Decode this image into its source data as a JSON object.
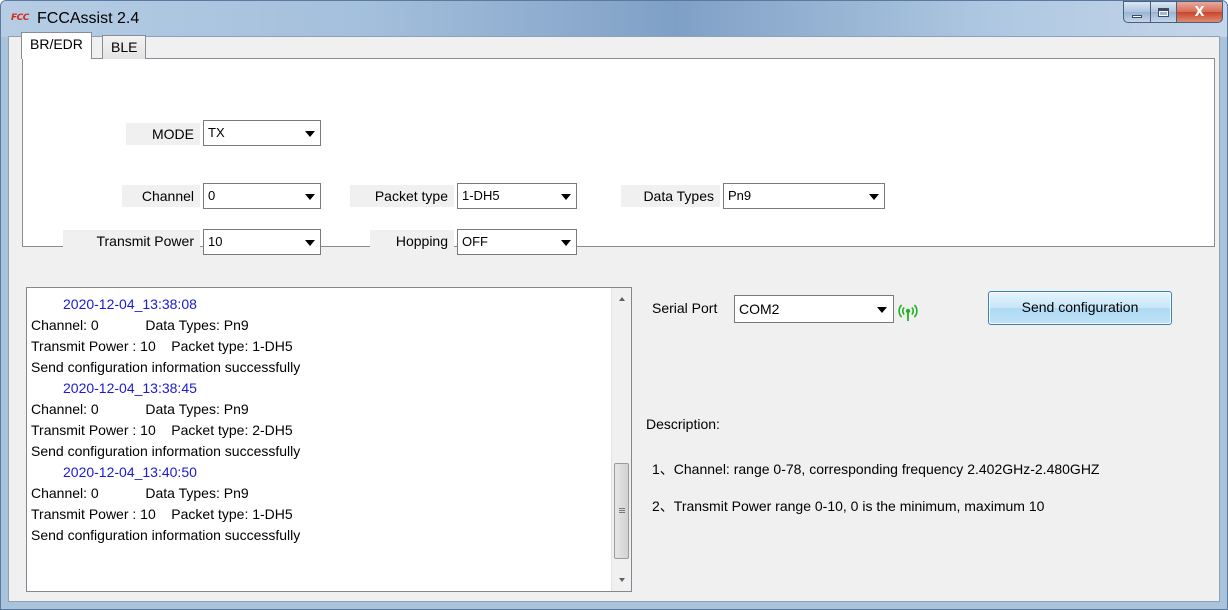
{
  "window": {
    "title": "FCCAssist 2.4",
    "icon_text": "FCC",
    "close_glyph": "X"
  },
  "tabs": [
    {
      "label": "BR/EDR",
      "active": true
    },
    {
      "label": "BLE",
      "active": false
    }
  ],
  "form": {
    "mode": {
      "label": "MODE",
      "value": "TX"
    },
    "channel": {
      "label": "Channel",
      "value": "0"
    },
    "packet_type": {
      "label": "Packet type",
      "value": "1-DH5"
    },
    "data_types": {
      "label": "Data Types",
      "value": "Pn9"
    },
    "transmit_power": {
      "label": "Transmit Power",
      "value": "10"
    },
    "hopping": {
      "label": "Hopping",
      "value": "OFF"
    }
  },
  "log": {
    "lines": [
      {
        "text": "2020-12-04_13:38:08",
        "kind": "timestamp"
      },
      {
        "text": "Channel: 0            Data Types: Pn9",
        "kind": "text"
      },
      {
        "text": "Transmit Power : 10    Packet type: 1-DH5",
        "kind": "text"
      },
      {
        "text": "Send configuration information successfully",
        "kind": "text"
      },
      {
        "text": "2020-12-04_13:38:45",
        "kind": "timestamp"
      },
      {
        "text": "Channel: 0            Data Types: Pn9",
        "kind": "text"
      },
      {
        "text": "Transmit Power : 10    Packet type: 2-DH5",
        "kind": "text"
      },
      {
        "text": "Send configuration information successfully",
        "kind": "text"
      },
      {
        "text": "2020-12-04_13:40:50",
        "kind": "timestamp"
      },
      {
        "text": "Channel: 0            Data Types: Pn9",
        "kind": "text"
      },
      {
        "text": "Transmit Power : 10    Packet type: 1-DH5",
        "kind": "text"
      },
      {
        "text": "Send configuration information successfully",
        "kind": "text"
      }
    ]
  },
  "serial": {
    "label": "Serial Port",
    "value": "COM2",
    "status_color": "#1fb31f"
  },
  "send_button": {
    "label": "Send configuration"
  },
  "description": {
    "title": "Description:",
    "items": [
      "1、Channel: range 0-78, corresponding frequency 2.402GHz-2.480GHZ",
      "2、Transmit Power  range 0-10, 0 is the minimum, maximum 10"
    ]
  }
}
